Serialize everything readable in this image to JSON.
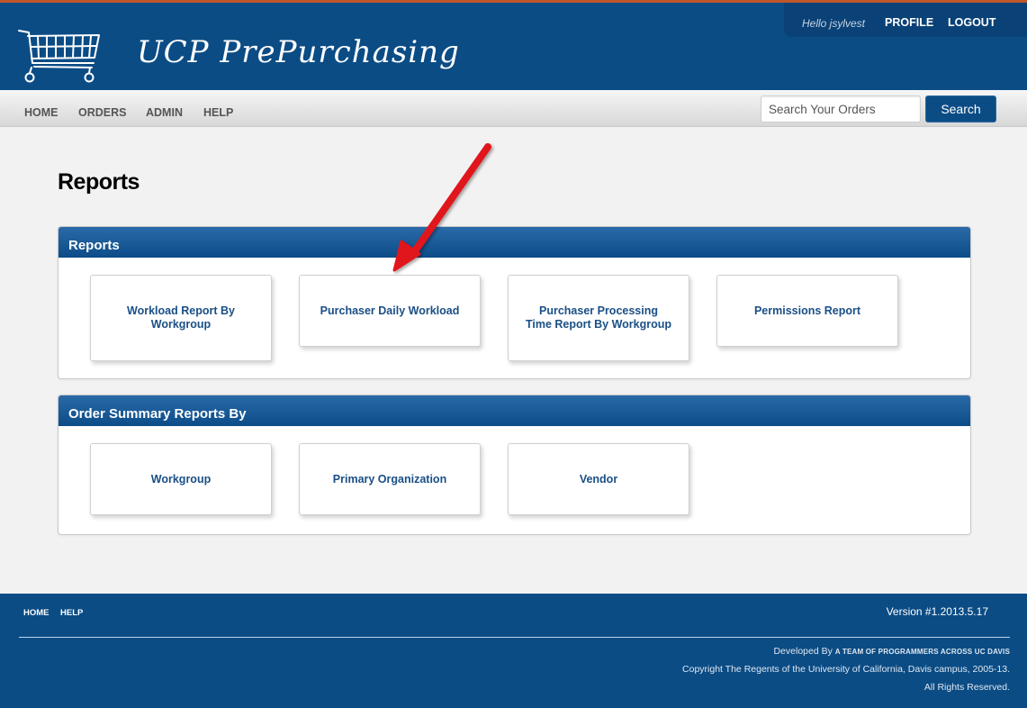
{
  "header": {
    "app_title": "UCP PrePurchasing",
    "greeting": "Hello jsylvest",
    "profile_label": "PROFILE",
    "logout_label": "LOGOUT",
    "brand_color": "#0b4c85"
  },
  "nav": {
    "items": [
      {
        "label": "HOME"
      },
      {
        "label": "ORDERS"
      },
      {
        "label": "ADMIN"
      },
      {
        "label": "HELP"
      }
    ]
  },
  "search": {
    "placeholder": "Search Your Orders",
    "button_label": "Search"
  },
  "main": {
    "page_title": "Reports",
    "panels": [
      {
        "title": "Reports",
        "cards": [
          {
            "label": "Workload Report By\nWorkgroup"
          },
          {
            "label": "Purchaser Daily Workload"
          },
          {
            "label": "Purchaser Processing\nTime Report By Workgroup"
          },
          {
            "label": "Permissions Report"
          }
        ]
      },
      {
        "title": "Order Summary Reports By",
        "cards": [
          {
            "label": "Workgroup"
          },
          {
            "label": "Primary Organization"
          },
          {
            "label": "Vendor"
          }
        ]
      }
    ]
  },
  "annotation": {
    "arrow_color": "#e0141b",
    "arrow_target": "Purchaser Daily Workload"
  },
  "footer": {
    "links": [
      {
        "label": "HOME"
      },
      {
        "label": "HELP"
      }
    ],
    "version": "Version #1.2013.5.17",
    "developed_by_prefix": "Developed By ",
    "developed_by_team": "A TEAM OF PROGRAMMERS ACROSS UC DAVIS",
    "copyright": "Copyright The Regents of the University of California, Davis campus, 2005-13.",
    "rights": "All Rights Reserved."
  }
}
